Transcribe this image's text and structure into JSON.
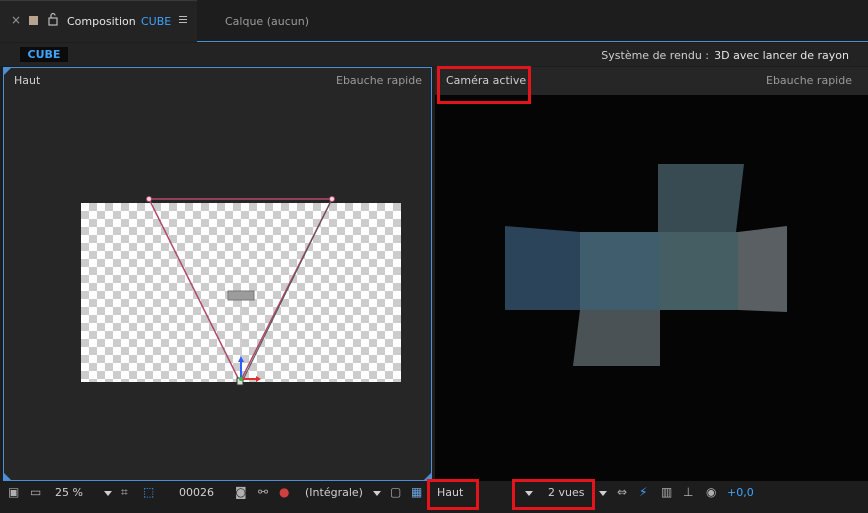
{
  "tabs": {
    "close_glyph": "×",
    "composition_label": "Composition",
    "composition_name": "CUBE",
    "layer_tab": "Calque  (aucun)"
  },
  "breadcrumb": {
    "current": "CUBE"
  },
  "renderer": {
    "label": "Système de rendu :",
    "value": "3D avec lancer de rayon"
  },
  "viewers": {
    "left": {
      "view_name": "Haut",
      "quality": "Ebauche rapide"
    },
    "right": {
      "view_name": "Caméra active",
      "quality": "Ebauche rapide"
    }
  },
  "toolbar": {
    "zoom": "25 %",
    "timecode": "00026",
    "resolution": "(Intégrale)",
    "view_select": "Haut",
    "layout_select": "2 vues",
    "exposure": "+0,0"
  },
  "colors": {
    "accent": "#3ea3ff",
    "highlight": "#e3141a",
    "panel_border": "#4b8fd6"
  },
  "icons": [
    "lock-icon",
    "menu-icon",
    "snapshot-icon",
    "channels-icon",
    "grid-icon",
    "transparency-grid-icon",
    "fast-previews-icon",
    "3d-view-icon",
    "flowchart-icon",
    "exposure-icon"
  ]
}
